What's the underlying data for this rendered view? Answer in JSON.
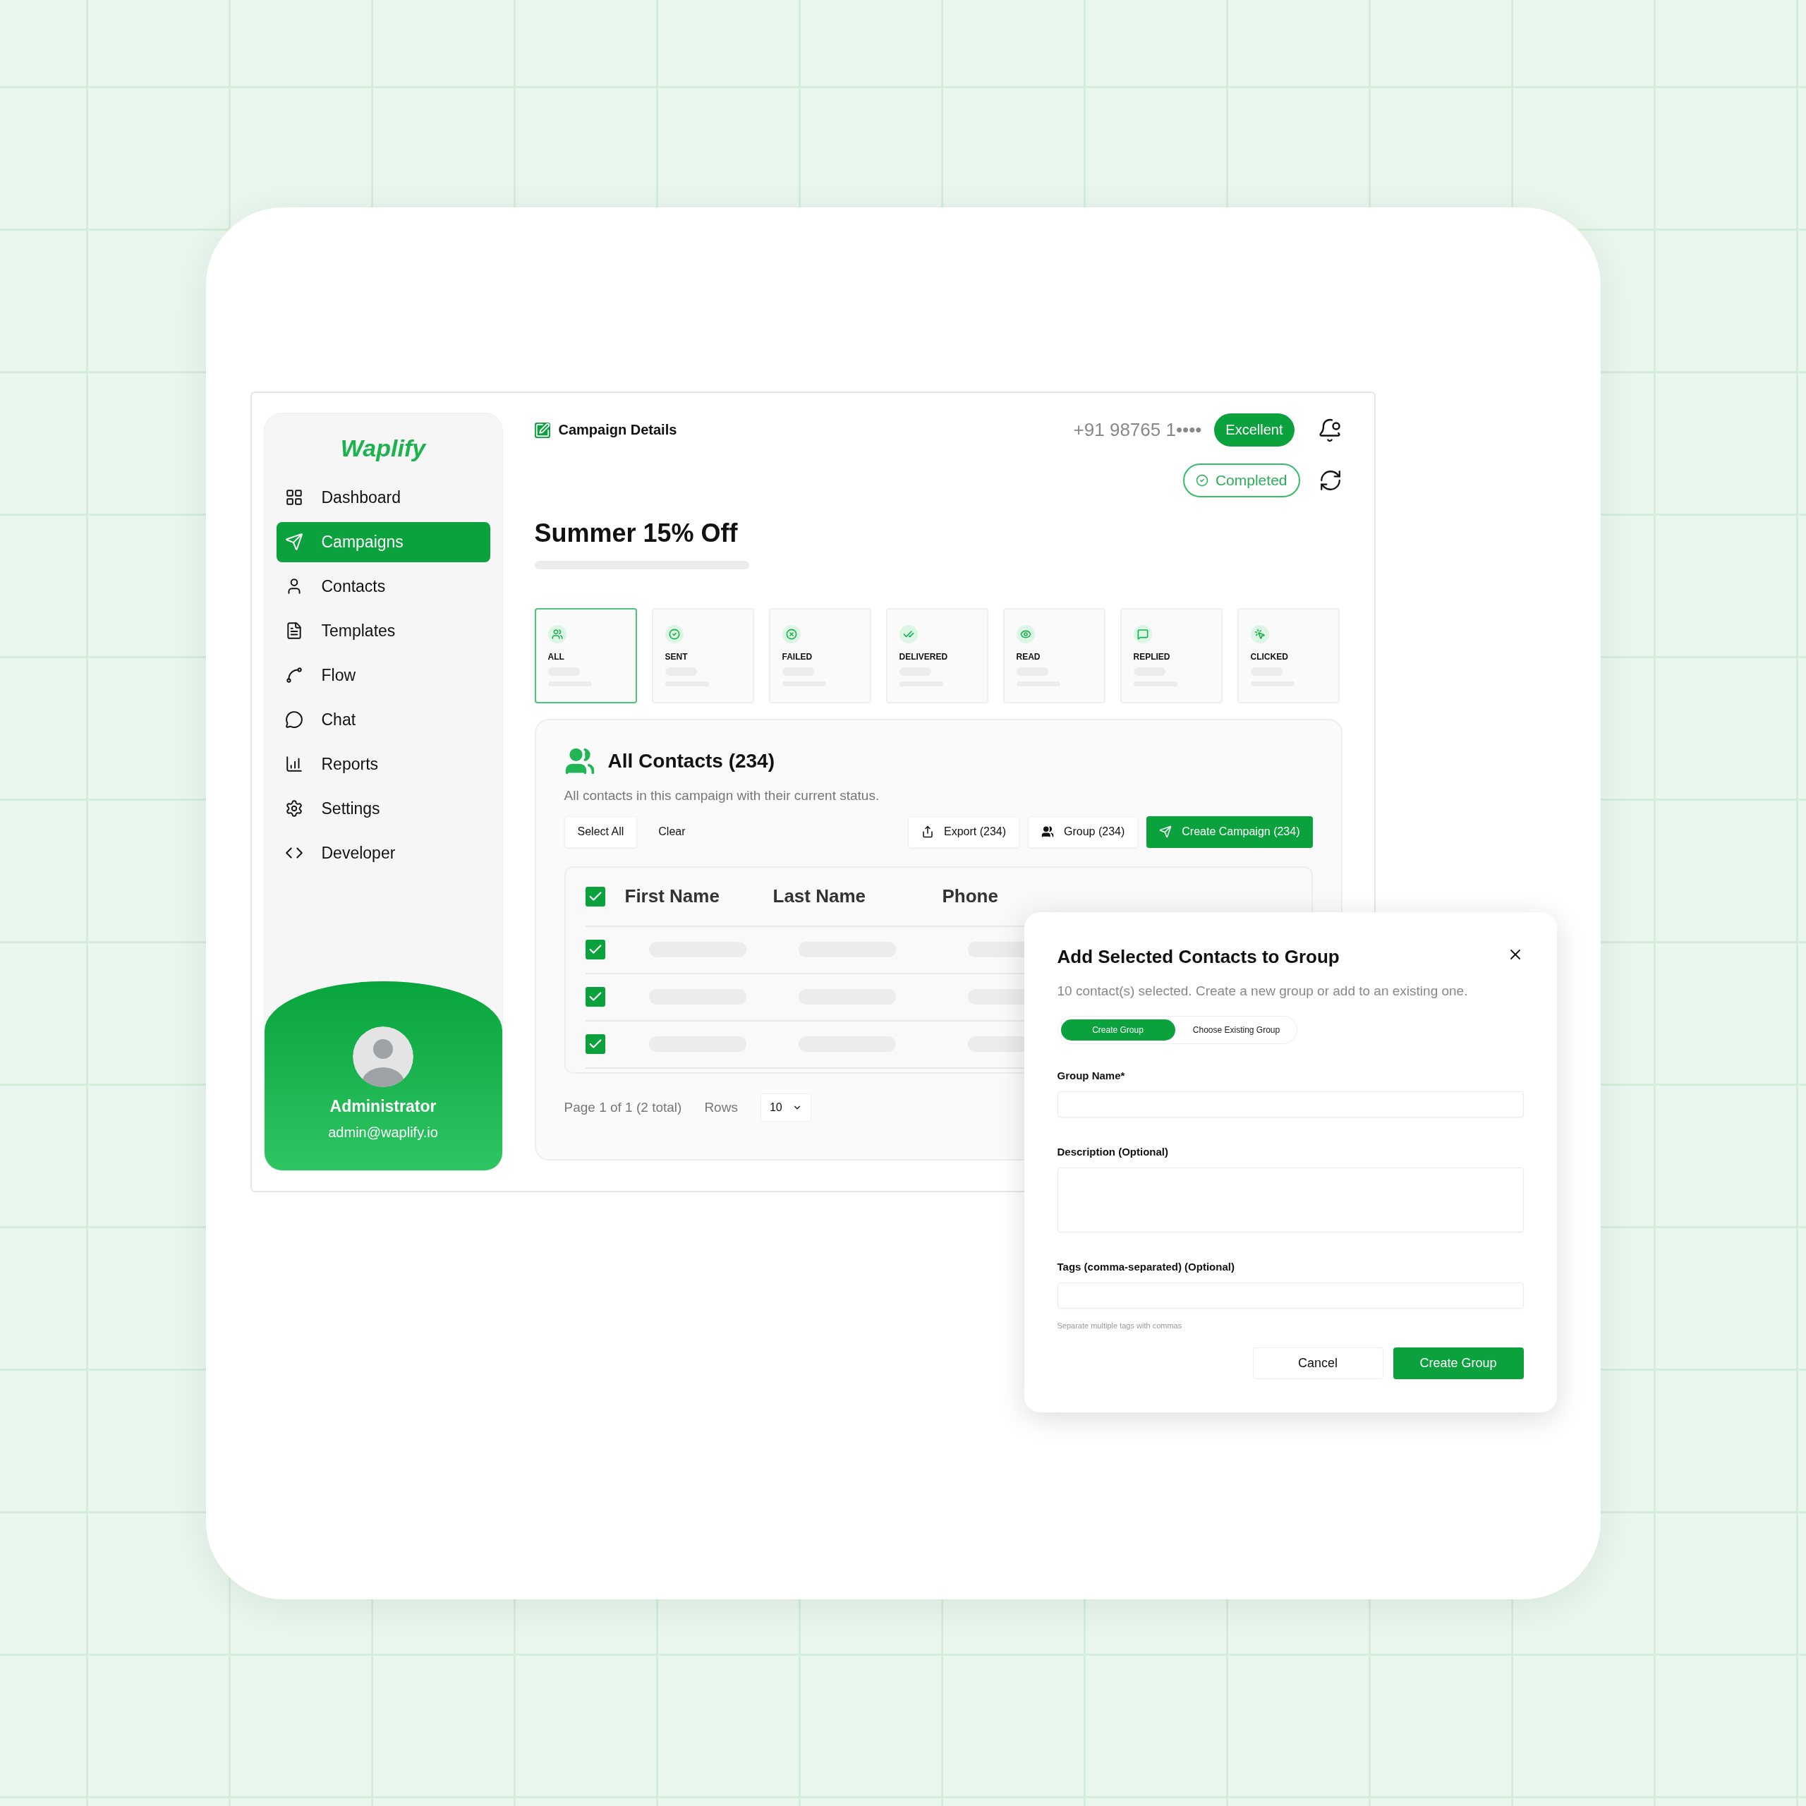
{
  "sidebar": {
    "logo": "Waplify",
    "items": [
      {
        "label": "Dashboard",
        "selected": false
      },
      {
        "label": "Campaigns",
        "selected": true
      },
      {
        "label": "Contacts",
        "selected": false
      },
      {
        "label": "Templates",
        "selected": false
      },
      {
        "label": "Flow",
        "selected": false
      },
      {
        "label": "Chat",
        "selected": false
      },
      {
        "label": "Reports",
        "selected": false
      },
      {
        "label": "Settings",
        "selected": false
      },
      {
        "label": "Developer",
        "selected": false
      }
    ],
    "profile": {
      "name": "Administrator",
      "email": "admin@waplify.io"
    }
  },
  "header": {
    "title": "Campaign Details",
    "phone": "+91 98765 1••••",
    "quality_badge": "Excellent",
    "status_badge": "Completed"
  },
  "campaign": {
    "name": "Summer 15% Off"
  },
  "stats": [
    {
      "label": "ALL",
      "selected": true
    },
    {
      "label": "SENT",
      "selected": false
    },
    {
      "label": "FAILED",
      "selected": false
    },
    {
      "label": "DELIVERED",
      "selected": false
    },
    {
      "label": "READ",
      "selected": false
    },
    {
      "label": "REPLIED",
      "selected": false
    },
    {
      "label": "CLICKED",
      "selected": false
    }
  ],
  "contacts": {
    "title": "All Contacts (234)",
    "description": "All contacts in this campaign with their current status.",
    "actions": [
      {
        "label": "Select All",
        "kind": "outline"
      },
      {
        "label": "Clear",
        "kind": "plain"
      },
      {
        "label": "Export (234)",
        "kind": "outline"
      },
      {
        "label": "Group (234)",
        "kind": "outline"
      },
      {
        "label": "Create Campaign (234)",
        "kind": "primary"
      }
    ],
    "table": {
      "header_checked": true,
      "columns": [
        "First Name",
        "Last Name",
        "Phone"
      ],
      "rows": [
        {
          "checked": true
        },
        {
          "checked": true
        },
        {
          "checked": true
        }
      ]
    },
    "pagination": {
      "summary": "Page 1 of 1 (2 total)",
      "rows_label": "Rows",
      "rows_value": "10"
    }
  },
  "dialog": {
    "title": "Add Selected Contacts to Group",
    "description": "10 contact(s) selected. Create a new group or add to an existing one.",
    "tabs": [
      {
        "label": "Create Group",
        "selected": true
      },
      {
        "label": "Choose Existing Group",
        "selected": false
      }
    ],
    "fields": [
      {
        "label": "Group Name*",
        "kind": "input"
      },
      {
        "label": "Description (Optional)",
        "kind": "textarea"
      },
      {
        "label": "Tags (comma-separated) (Optional)",
        "kind": "input",
        "hint": "Separate multiple tags with commas"
      }
    ],
    "buttons": [
      {
        "label": "Cancel",
        "kind": "secondary"
      },
      {
        "label": "Create Group",
        "kind": "primary"
      }
    ]
  }
}
